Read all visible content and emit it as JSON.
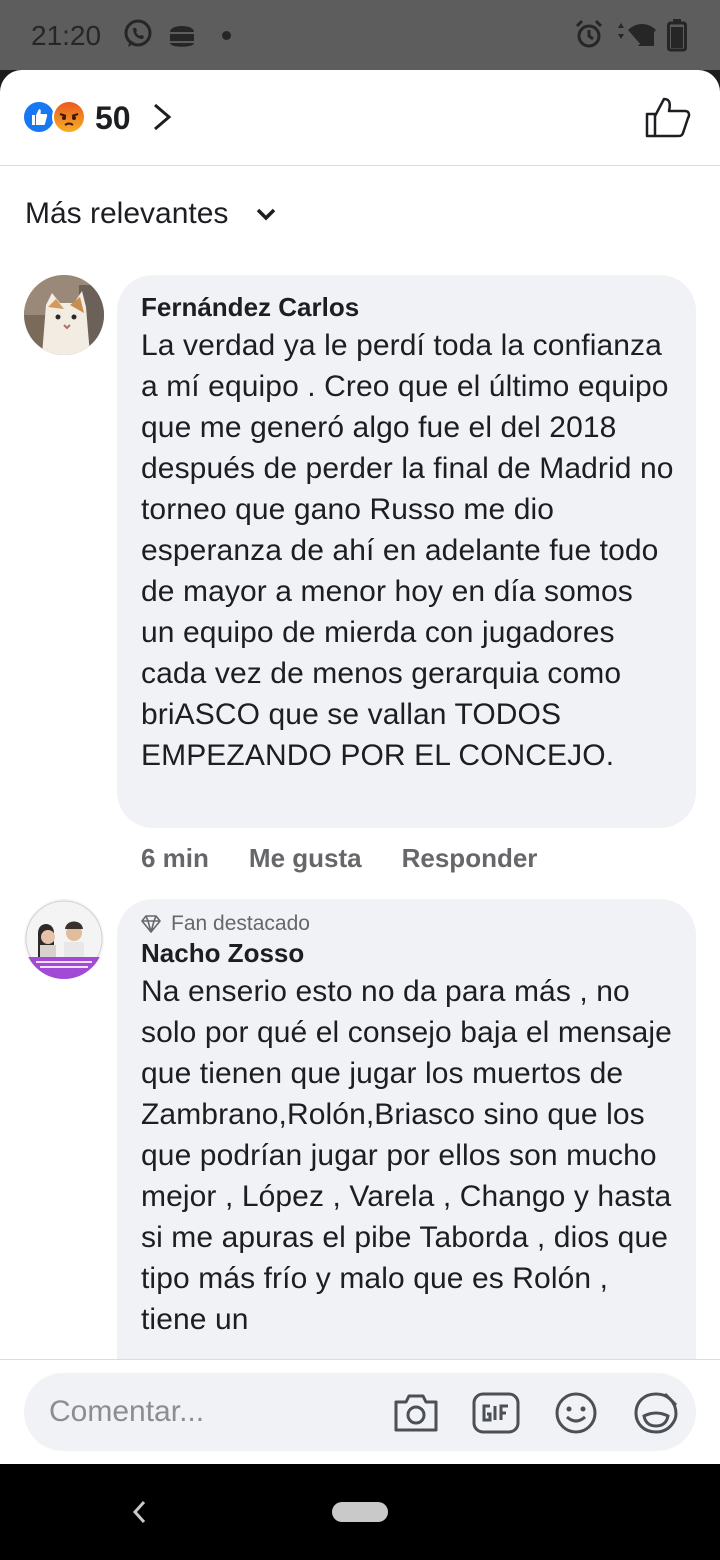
{
  "status_bar": {
    "time": "21:20",
    "notification_icons": [
      "whatsapp-icon",
      "burger-king-icon",
      "dot-icon"
    ],
    "system_icons": [
      "alarm-icon",
      "signal-icon",
      "battery-icon"
    ]
  },
  "reactions": {
    "count": "50",
    "types": [
      "like",
      "angry"
    ]
  },
  "sort": {
    "label": "Más relevantes"
  },
  "comments": [
    {
      "author": "Fernández Carlos",
      "text": "La verdad ya le perdí toda la confianza a mí equipo . Creo que el último equipo que me generó algo fue el del 2018 después de perder la final de Madrid no torneo que gano Russo me dio esperanza  de ahí en adelante fue todo de mayor a menor hoy en día somos un equipo de mierda con jugadores cada vez de menos gerarquia como briASCO que se vallan TODOS EMPEZANDO POR EL CONCEJO.",
      "time": "6 min",
      "like_label": "Me gusta",
      "reply_label": "Responder"
    },
    {
      "badge": "Fan destacado",
      "author": "Nacho Zosso",
      "text": "Na enserio esto no da para más , no solo por qué el consejo baja el mensaje que tienen que jugar los muertos de Zambrano,Rolón,Briasco sino que los que podrían jugar por ellos son mucho mejor , López , Varela , Chango y hasta si me apuras el pibe Taborda , dios que tipo más frío y malo que es Rolón , tiene un"
    }
  ],
  "composer": {
    "placeholder": "Comentar..."
  },
  "colors": {
    "facebook_blue": "#1877f2",
    "bubble_bg": "#f0f2f5",
    "secondary_text": "#65676b",
    "angry_orange": "#f0693a"
  }
}
